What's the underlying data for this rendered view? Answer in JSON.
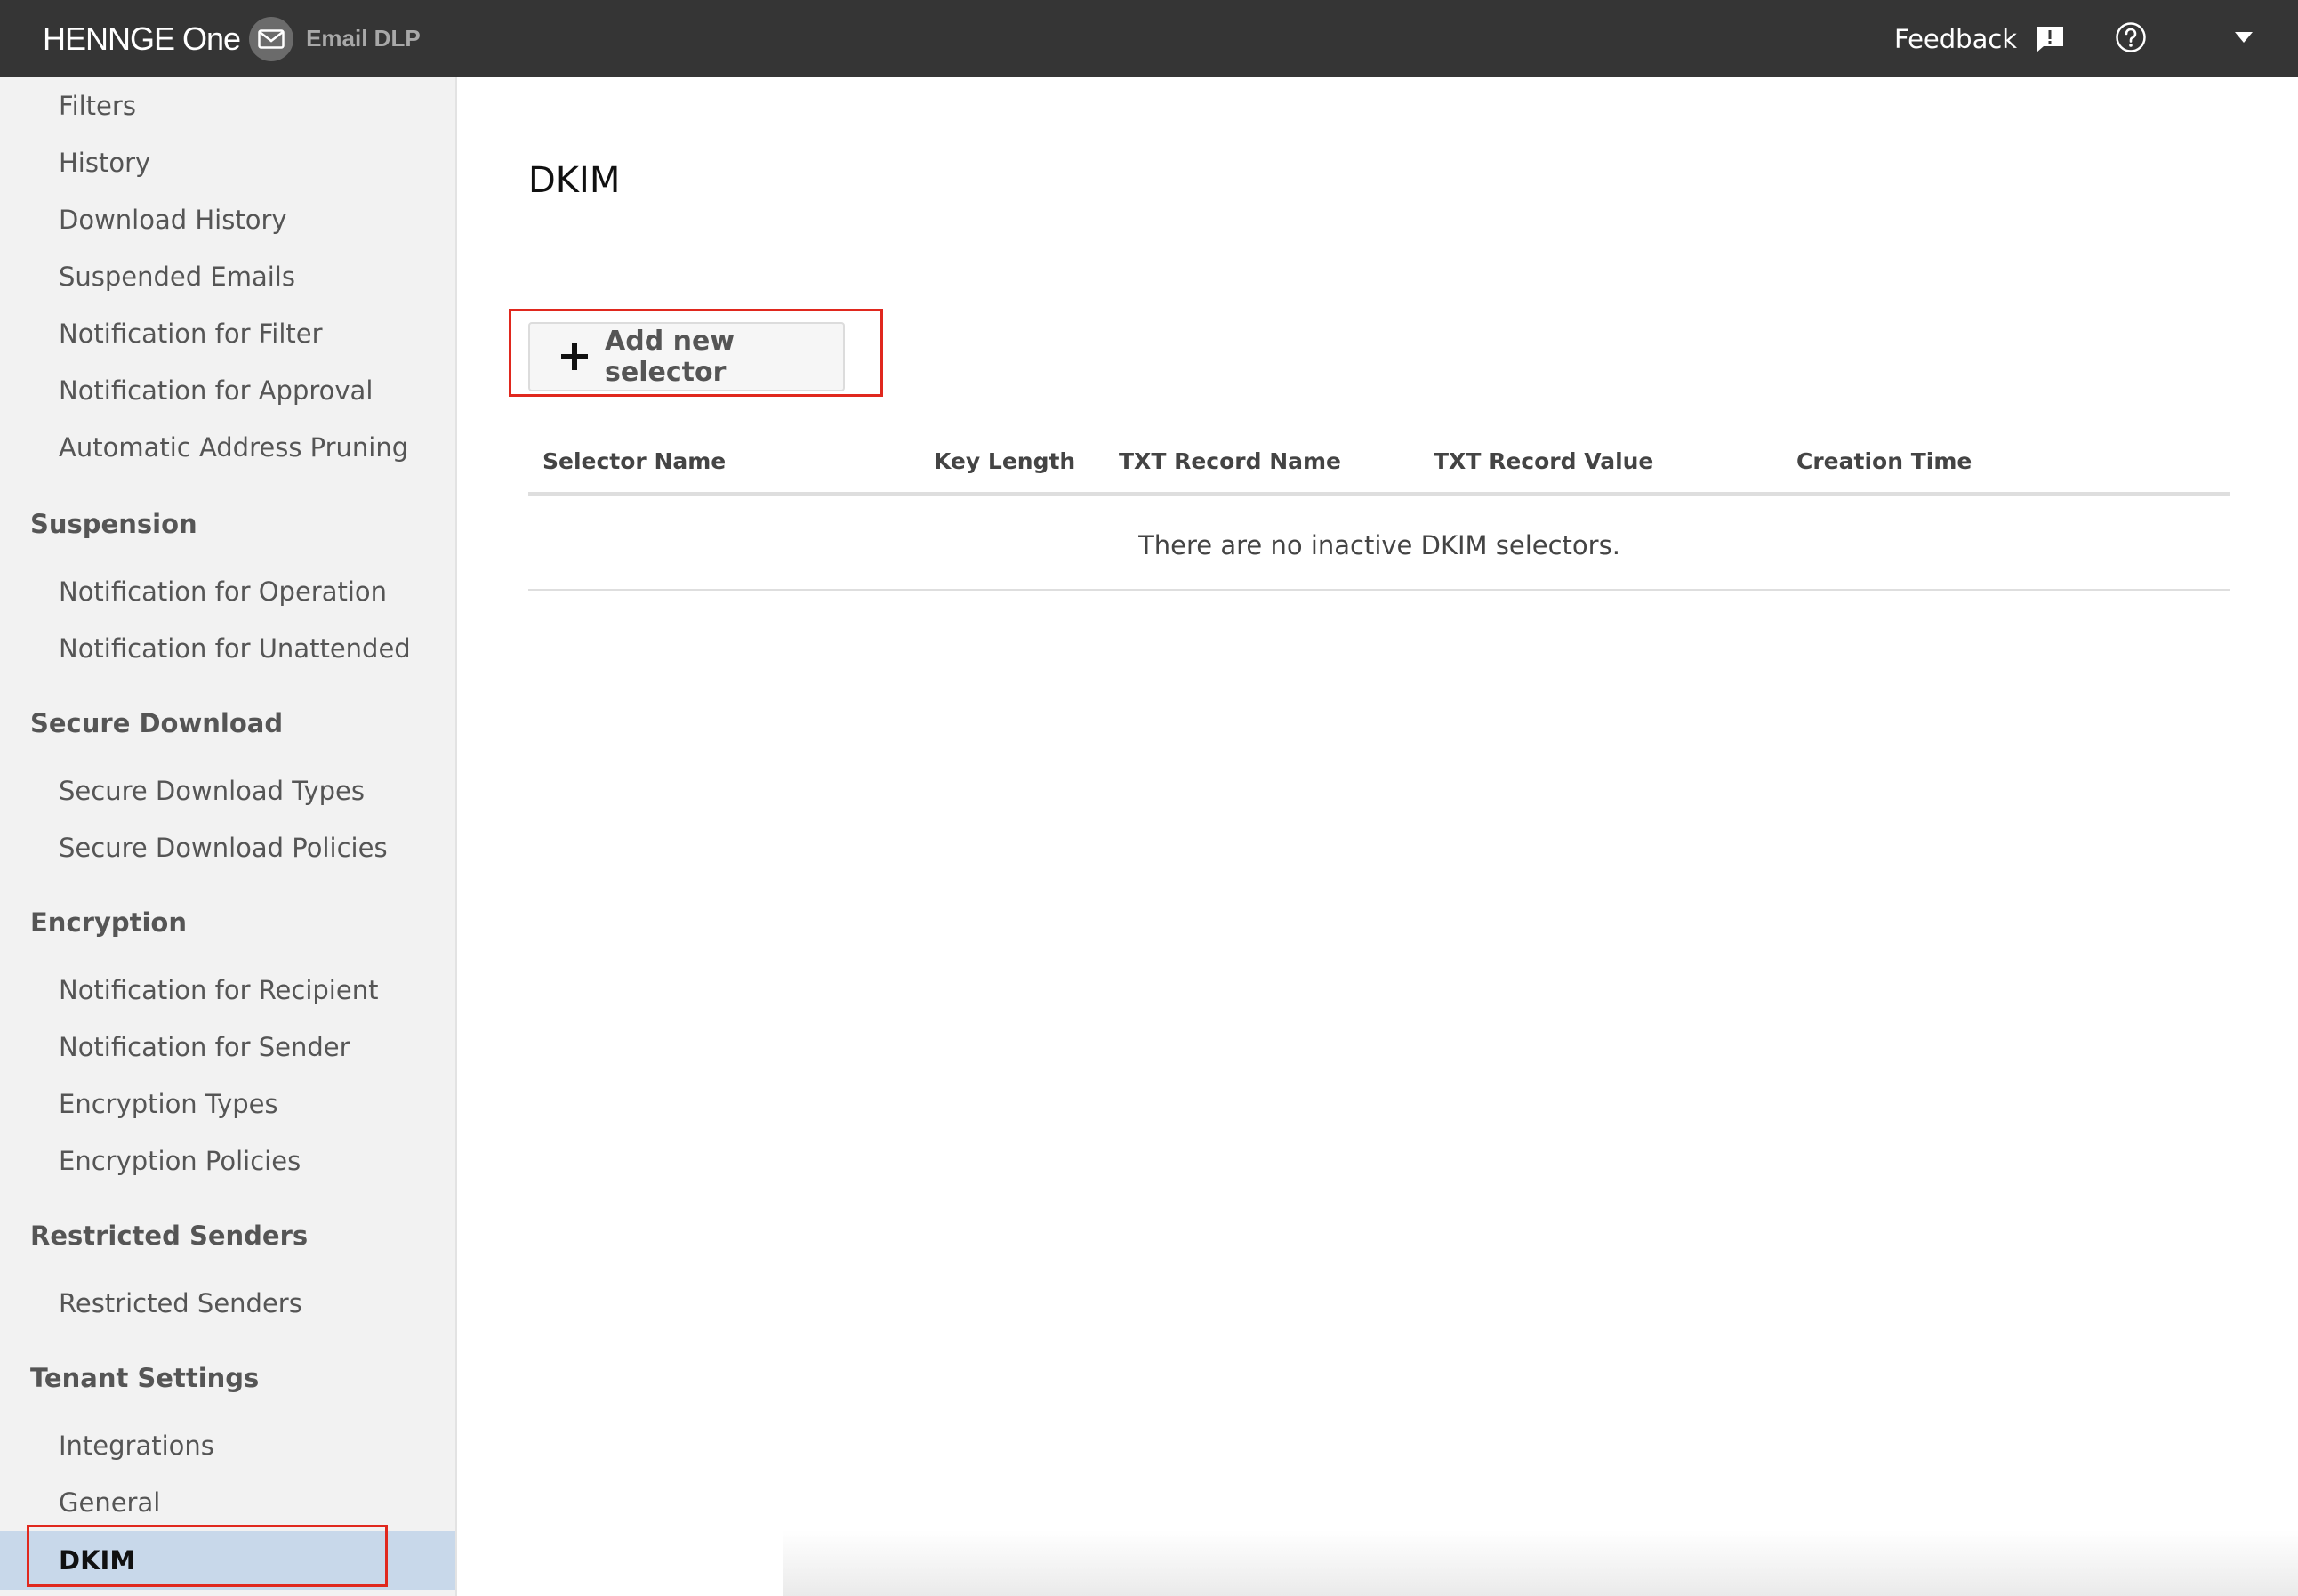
{
  "header": {
    "brand": "HENNGE One",
    "app_name": "Email DLP",
    "feedback_label": "Feedback",
    "icons": [
      "mail-icon",
      "feedback-icon",
      "help-icon",
      "chevron-down-icon"
    ]
  },
  "sidebar": {
    "top_items": [
      "Filters",
      "History",
      "Download History",
      "Suspended Emails",
      "Notification for Filter",
      "Notification for Approval",
      "Automatic Address Pruning"
    ],
    "sections": [
      {
        "title": "Suspension",
        "items": [
          "Notification for Operation",
          "Notification for Unattended"
        ]
      },
      {
        "title": "Secure Download",
        "items": [
          "Secure Download Types",
          "Secure Download Policies"
        ]
      },
      {
        "title": "Encryption",
        "items": [
          "Notification for Recipient",
          "Notification for Sender",
          "Encryption Types",
          "Encryption Policies"
        ]
      },
      {
        "title": "Restricted Senders",
        "items": [
          "Restricted Senders"
        ]
      },
      {
        "title": "Tenant Settings",
        "items": [
          "Integrations",
          "General",
          "DKIM"
        ]
      }
    ],
    "active_item": "DKIM"
  },
  "main": {
    "title": "DKIM",
    "add_button_label": "Add new selector",
    "table": {
      "columns": [
        "Selector Name",
        "Key Length",
        "TXT Record Name",
        "TXT Record Value",
        "Creation Time"
      ],
      "empty_message": "There are no inactive DKIM selectors."
    }
  },
  "colors": {
    "header_bg": "#353535",
    "sidebar_bg": "#f2f2f2",
    "active_bg": "#c8d8ea",
    "highlight": "#e0281e"
  }
}
